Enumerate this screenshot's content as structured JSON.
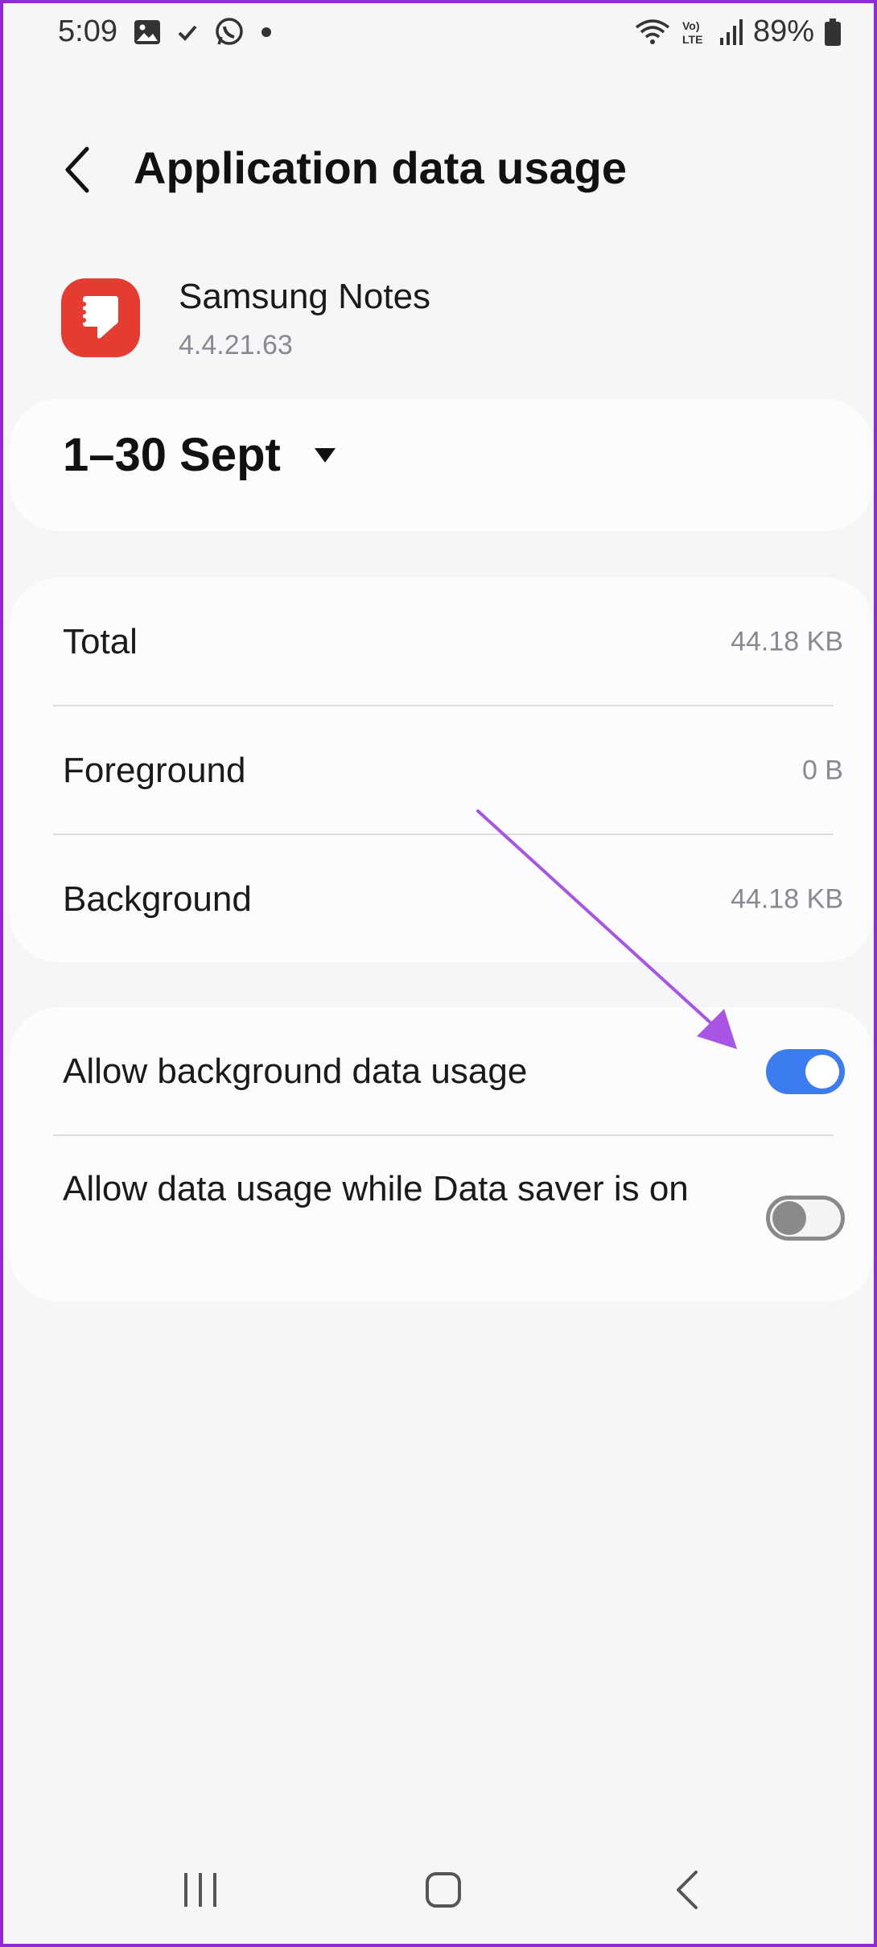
{
  "status_bar": {
    "time": "5:09",
    "battery": "89%",
    "icons": [
      "gallery-icon",
      "check-icon",
      "whatsapp-icon",
      "dot-icon",
      "wifi-icon",
      "volte-icon",
      "signal-icon",
      "battery-icon"
    ]
  },
  "header": {
    "title": "Application data usage",
    "back_icon": "chevron-left-icon"
  },
  "app": {
    "name": "Samsung Notes",
    "version": "4.4.21.63",
    "icon": "samsung-notes-icon",
    "icon_color": "#e53b30"
  },
  "period": {
    "label": "1–30 Sept",
    "icon": "caret-down-icon"
  },
  "usage": {
    "rows": [
      {
        "label": "Total",
        "value": "44.18 KB"
      },
      {
        "label": "Foreground",
        "value": "0 B"
      },
      {
        "label": "Background",
        "value": "44.18 KB"
      }
    ]
  },
  "toggles": [
    {
      "label": "Allow background data usage",
      "state": "on"
    },
    {
      "label": "Allow data usage while Data saver is on",
      "state": "off"
    }
  ],
  "colors": {
    "accent": "#3b7cf0",
    "annotation": "#a855e6",
    "frame": "#8e2bd3"
  },
  "nav_bar": {
    "icons": [
      "recents-icon",
      "home-icon",
      "back-icon"
    ]
  }
}
